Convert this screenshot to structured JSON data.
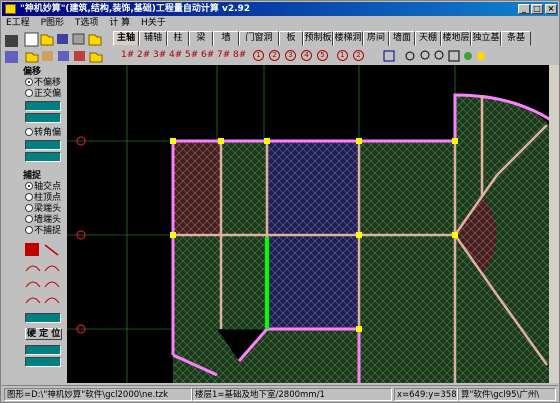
{
  "window": {
    "title": "\"神机妙算\"(建筑,结构,装饰,基础)工程量自动计算 v2.92",
    "buttons": {
      "minimize": "_",
      "maximize": "□",
      "close": "×"
    }
  },
  "menu": [
    "E工程",
    "P图形",
    "T选项",
    "计 算",
    "H关于"
  ],
  "tabs": [
    "主轴",
    "辅轴",
    "柱",
    "梁",
    "墙",
    "门窗洞",
    "板",
    "预制板",
    "楼梯洞",
    "房间",
    "墙面",
    "天棚",
    "楼地层",
    "独立基",
    "条基"
  ],
  "active_tab": "主轴",
  "floors": [
    "1#",
    "2#",
    "3#",
    "4#",
    "5#",
    "6#",
    "7#",
    "8#"
  ],
  "floor_circles": [
    "1",
    "2",
    "3",
    "4",
    "5",
    "1",
    "2"
  ],
  "left_panel": {
    "offset_group_label": "偏移",
    "offset_options": [
      "不偏移",
      "正交偏",
      "转角偏"
    ],
    "offset_selected": 0,
    "snap_group_label": "捕捉",
    "snap_options": [
      "轴交点",
      "柱顶点",
      "梁端头",
      "墙端头",
      "不捕捉"
    ],
    "snap_selected": 0,
    "fix_button": "硬 定 位"
  },
  "status": {
    "file": "图形=D:\\\"神机妙算\"软件\\gcl2000\\ne.tzk",
    "floor": "楼层1=基础及地下室/2800mm/1",
    "coords": "x=649:y=358",
    "company": "算\"软件\\gcl95\\广州\\"
  },
  "colors": {
    "accent": "#000080",
    "wall_pink": "#ff80ff",
    "beam_tan": "#e0b0a0",
    "column_yellow": "#ffff00",
    "axis_green": "#00ff00"
  }
}
